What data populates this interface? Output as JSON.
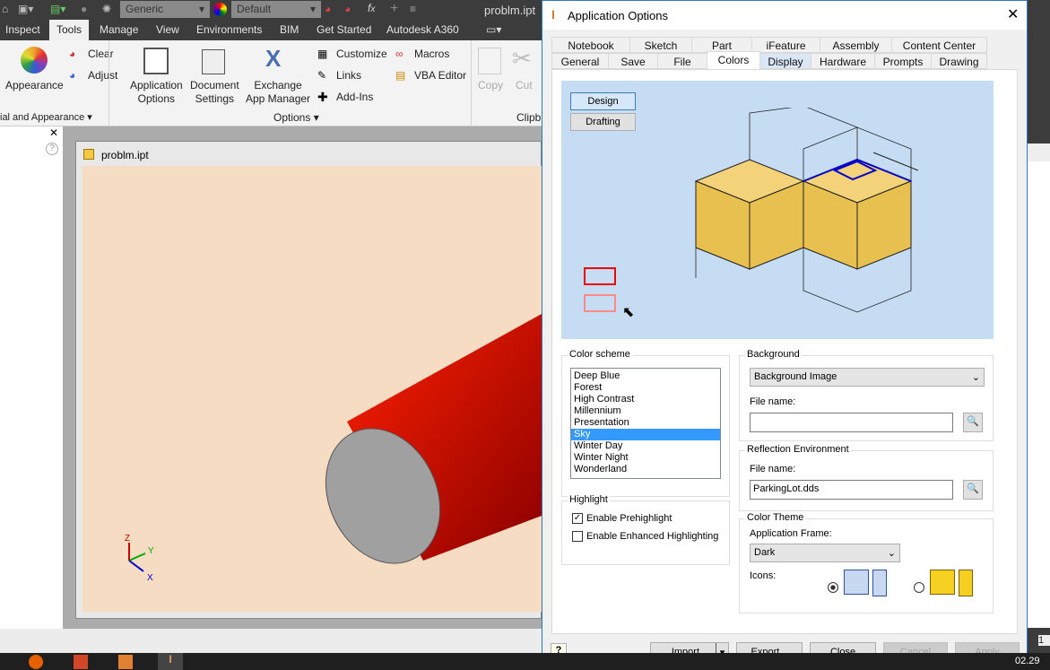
{
  "qat": {
    "material": "Generic",
    "appearance": "Default",
    "filename": "problm.ipt"
  },
  "ribbon_tabs": [
    "Inspect",
    "Tools",
    "Manage",
    "View",
    "Environments",
    "BIM",
    "Get Started",
    "Autodesk A360"
  ],
  "ribbon": {
    "appearance": "Appearance",
    "clear": "Clear",
    "adjust": "Adjust",
    "app_options": [
      "Application",
      "Options"
    ],
    "doc_settings": [
      "Document",
      "Settings"
    ],
    "exchange": [
      "Exchange",
      "App Manager"
    ],
    "customize": "Customize",
    "links": "Links",
    "addins": "Add-Ins",
    "macros": "Macros",
    "vba": "VBA Editor",
    "copy": "Copy",
    "cut": "Cut",
    "panel_material": "ial and Appearance",
    "panel_options": "Options",
    "panel_clip": "Clipb"
  },
  "document": {
    "title": "problm.ipt"
  },
  "viewcube": {
    "x": "X",
    "y": "Y",
    "z": "Z"
  },
  "dialog": {
    "title": "Application Options",
    "tabs_row1": [
      "Notebook",
      "Sketch",
      "Part",
      "iFeature",
      "Assembly",
      "Content Center"
    ],
    "tabs_row2": [
      "General",
      "Save",
      "File",
      "Colors",
      "Display",
      "Hardware",
      "Prompts",
      "Drawing"
    ],
    "active_tab": "Colors",
    "preview": {
      "design": "Design",
      "drafting": "Drafting"
    },
    "color_scheme": {
      "label": "Color scheme",
      "items": [
        "Deep Blue",
        "Forest",
        "High Contrast",
        "Millennium",
        "Presentation",
        "Sky",
        "Winter Day",
        "Winter Night",
        "Wonderland"
      ],
      "selected": "Sky"
    },
    "highlight": {
      "label": "Highlight",
      "prehighlight": "Enable Prehighlight",
      "prehighlight_checked": true,
      "enhanced": "Enable Enhanced Highlighting",
      "enhanced_checked": false
    },
    "background": {
      "label": "Background",
      "value": "Background Image",
      "file_label": "File name:",
      "file_value": ""
    },
    "reflection": {
      "label": "Reflection Environment",
      "file_label": "File name:",
      "file_value": "ParkingLot.dds"
    },
    "theme": {
      "label": "Color Theme",
      "frame_label": "Application Frame:",
      "frame_value": "Dark",
      "icons_label": "Icons:"
    },
    "buttons": {
      "import": "Import...",
      "export": "Export...",
      "close": "Close",
      "cancel": "Cancel",
      "apply": "Apply"
    }
  },
  "taskbar": {
    "time": "02.29"
  },
  "colors": {
    "accent": "#3399ff",
    "preview_bg": "#c5dcf2",
    "cylinder": "#ff1a00",
    "viewport": "#f5dcc3"
  }
}
